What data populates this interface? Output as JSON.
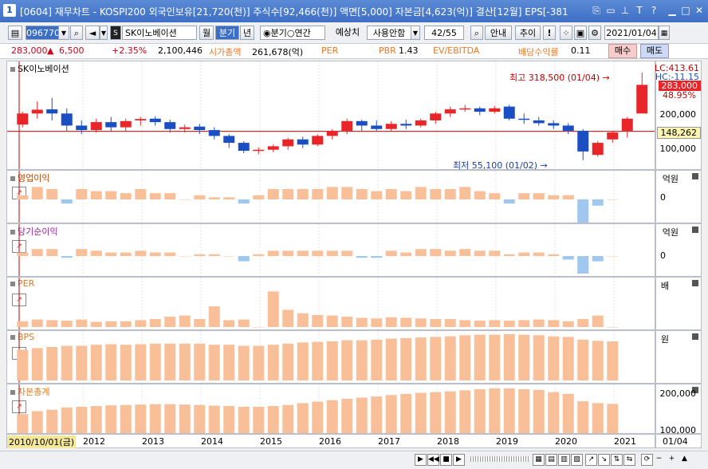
{
  "window": {
    "number": "1",
    "title": "[0604] 재무차트 - KOSPI200 외국인보유[21,720(천)] 주식수[92,466(천)] 액면[5,000] 자본금[4,623(억)] 결산[12월] EPS[-381"
  },
  "toolbar": {
    "code": "096770",
    "stock_name": "SK이노베이션",
    "period_month": "월",
    "period_quarter": "분기",
    "period_year": "년",
    "radio_quarter": "분기",
    "radio_year": "연간",
    "estimate_label": "예상치",
    "estimate_value": "사용안함",
    "page": "42/55",
    "guide_btn": "안내",
    "add_btn": "추이",
    "date": "2021/01/04"
  },
  "quote": {
    "price": "283,000",
    "change": "6,500",
    "change_pct": "+2.35%",
    "volume": "2,100,446",
    "mcap_label": "시가총액",
    "mcap_value": "261,678(억)",
    "per_label": "PER",
    "pbr_label": "PBR",
    "pbr_value": "1.43",
    "ev_label": "EV/EBITDA",
    "div_label": "배당수익률",
    "div_value": "0.11",
    "buy_btn": "매수",
    "sell_btn": "매도"
  },
  "panels": {
    "price_label": "SK이노베이션",
    "op_label": "영업이익",
    "net_label": "당기순이익",
    "per_label": "PER",
    "bps_label": "BPS",
    "equity_label": "자본총계",
    "unit_won_100m": "억원",
    "unit_times": "배",
    "unit_won": "원",
    "zero": "0"
  },
  "price_axis": {
    "lc": "LC:413.61",
    "hc": "HC:-11.15",
    "current": "283,000",
    "pct": "48.95%",
    "ref": "148,262",
    "t200k": "200,000",
    "t100k": "100,000"
  },
  "annotations": {
    "high": "최고 318,500 (01/04)",
    "low": "최저 55,100 (01/02)"
  },
  "equity_axis": {
    "t200k": "200,000",
    "t100k": "100,000"
  },
  "xaxis": {
    "start_date": "2010/10/01(금)",
    "years": [
      "2012",
      "2013",
      "2014",
      "2015",
      "2016",
      "2017",
      "2018",
      "2019",
      "2020",
      "2021"
    ],
    "end_label": "01/04"
  },
  "colors": {
    "up": "#e8262a",
    "down": "#1a4fc4",
    "bar": "#f9bf98",
    "neg_bar": "#9fc7ef",
    "ref_line": "#c40000"
  },
  "chart_data": {
    "type": "candlestick",
    "quarters": 43,
    "ylim_price": [
      55100,
      318500
    ],
    "candles": [
      [
        168000,
        200000,
        160000,
        205000
      ],
      [
        200000,
        211000,
        185000,
        235000
      ],
      [
        212000,
        200000,
        180000,
        245000
      ],
      [
        200000,
        165000,
        150000,
        215000
      ],
      [
        165000,
        152000,
        140000,
        180000
      ],
      [
        152000,
        175000,
        145000,
        185000
      ],
      [
        175000,
        160000,
        150000,
        190000
      ],
      [
        160000,
        178000,
        150000,
        185000
      ],
      [
        180000,
        184000,
        165000,
        190000
      ],
      [
        185000,
        175000,
        165000,
        192000
      ],
      [
        175000,
        155000,
        145000,
        182000
      ],
      [
        155000,
        160000,
        145000,
        168000
      ],
      [
        162000,
        152000,
        140000,
        170000
      ],
      [
        152000,
        135000,
        125000,
        160000
      ],
      [
        135000,
        115000,
        100000,
        140000
      ],
      [
        115000,
        92000,
        85000,
        120000
      ],
      [
        92000,
        95000,
        82000,
        102000
      ],
      [
        95000,
        105000,
        88000,
        110000
      ],
      [
        105000,
        125000,
        95000,
        130000
      ],
      [
        125000,
        110000,
        100000,
        133000
      ],
      [
        110000,
        135000,
        105000,
        140000
      ],
      [
        135000,
        150000,
        125000,
        155000
      ],
      [
        150000,
        178000,
        140000,
        185000
      ],
      [
        178000,
        165000,
        150000,
        182000
      ],
      [
        165000,
        155000,
        150000,
        180000
      ],
      [
        155000,
        170000,
        150000,
        178000
      ],
      [
        170000,
        165000,
        155000,
        182000
      ],
      [
        165000,
        180000,
        160000,
        185000
      ],
      [
        180000,
        200000,
        170000,
        205000
      ],
      [
        200000,
        212000,
        190000,
        220000
      ],
      [
        212000,
        215000,
        205000,
        225000
      ],
      [
        215000,
        205000,
        195000,
        220000
      ],
      [
        205000,
        215000,
        200000,
        222000
      ],
      [
        220000,
        185000,
        180000,
        225000
      ],
      [
        185000,
        182000,
        170000,
        200000
      ],
      [
        180000,
        172000,
        165000,
        190000
      ],
      [
        172000,
        165000,
        155000,
        180000
      ],
      [
        165000,
        150000,
        140000,
        172000
      ],
      [
        150000,
        90000,
        65000,
        155000
      ],
      [
        80000,
        115000,
        75000,
        120000
      ],
      [
        125000,
        145000,
        115000,
        150000
      ],
      [
        150000,
        185000,
        130000,
        190000
      ],
      [
        200000,
        283000,
        200000,
        318500
      ]
    ],
    "operating_profit": [
      0.2,
      0.6,
      0.5,
      -0.2,
      0.5,
      0.4,
      0.4,
      0.3,
      0.5,
      0.3,
      0.3,
      0.0,
      0.2,
      0.1,
      0.1,
      -0.2,
      0.2,
      0.5,
      0.5,
      0.5,
      0.5,
      0.6,
      0.6,
      0.5,
      0.4,
      0.5,
      0.4,
      0.6,
      0.5,
      0.5,
      0.6,
      0.4,
      0.3,
      -0.2,
      0.3,
      0.3,
      0.2,
      0.2,
      -1.2,
      -0.3,
      0.0
    ],
    "net_income": [
      0.2,
      0.4,
      0.4,
      -0.1,
      0.4,
      0.3,
      0.2,
      0.2,
      0.3,
      0.2,
      0.2,
      0.0,
      0.1,
      0.1,
      0.0,
      -0.3,
      0.1,
      0.3,
      0.3,
      0.3,
      0.3,
      0.3,
      0.3,
      -0.1,
      -0.1,
      0.3,
      0.2,
      0.4,
      0.4,
      0.3,
      0.4,
      0.3,
      0.3,
      0.1,
      0.2,
      0.2,
      0.1,
      -0.2,
      -1.0,
      -0.3,
      0.0
    ],
    "per": [
      1.0,
      1.3,
      1.2,
      1.1,
      1.3,
      0.9,
      1.0,
      1.0,
      1.2,
      1.4,
      1.8,
      2.0,
      1.4,
      3.6,
      1.2,
      1.3,
      0.0,
      6.2,
      3.0,
      2.4,
      2.1,
      2.0,
      1.8,
      1.6,
      1.5,
      1.7,
      1.6,
      1.5,
      1.4,
      1.4,
      1.2,
      1.1,
      1.2,
      1.1,
      1.2,
      1.3,
      1.2,
      1.0,
      1.4,
      2.0,
      0.0
    ],
    "bps": [
      0.55,
      0.58,
      0.6,
      0.62,
      0.62,
      0.64,
      0.65,
      0.64,
      0.65,
      0.66,
      0.66,
      0.66,
      0.66,
      0.64,
      0.64,
      0.62,
      0.62,
      0.64,
      0.66,
      0.68,
      0.69,
      0.7,
      0.72,
      0.72,
      0.73,
      0.75,
      0.76,
      0.77,
      0.78,
      0.79,
      0.81,
      0.82,
      0.82,
      0.83,
      0.82,
      0.81,
      0.79,
      0.78,
      0.73,
      0.71,
      0.7
    ],
    "equity": [
      130000,
      138000,
      142000,
      148000,
      150000,
      152000,
      154000,
      155000,
      156000,
      157000,
      157000,
      156000,
      155000,
      153000,
      152000,
      150000,
      150000,
      152000,
      155000,
      160000,
      164000,
      168000,
      172000,
      175000,
      178000,
      182000,
      185000,
      188000,
      190000,
      192000,
      195000,
      198000,
      200000,
      200000,
      198000,
      196000,
      190000,
      185000,
      165000,
      160000,
      158000
    ]
  }
}
